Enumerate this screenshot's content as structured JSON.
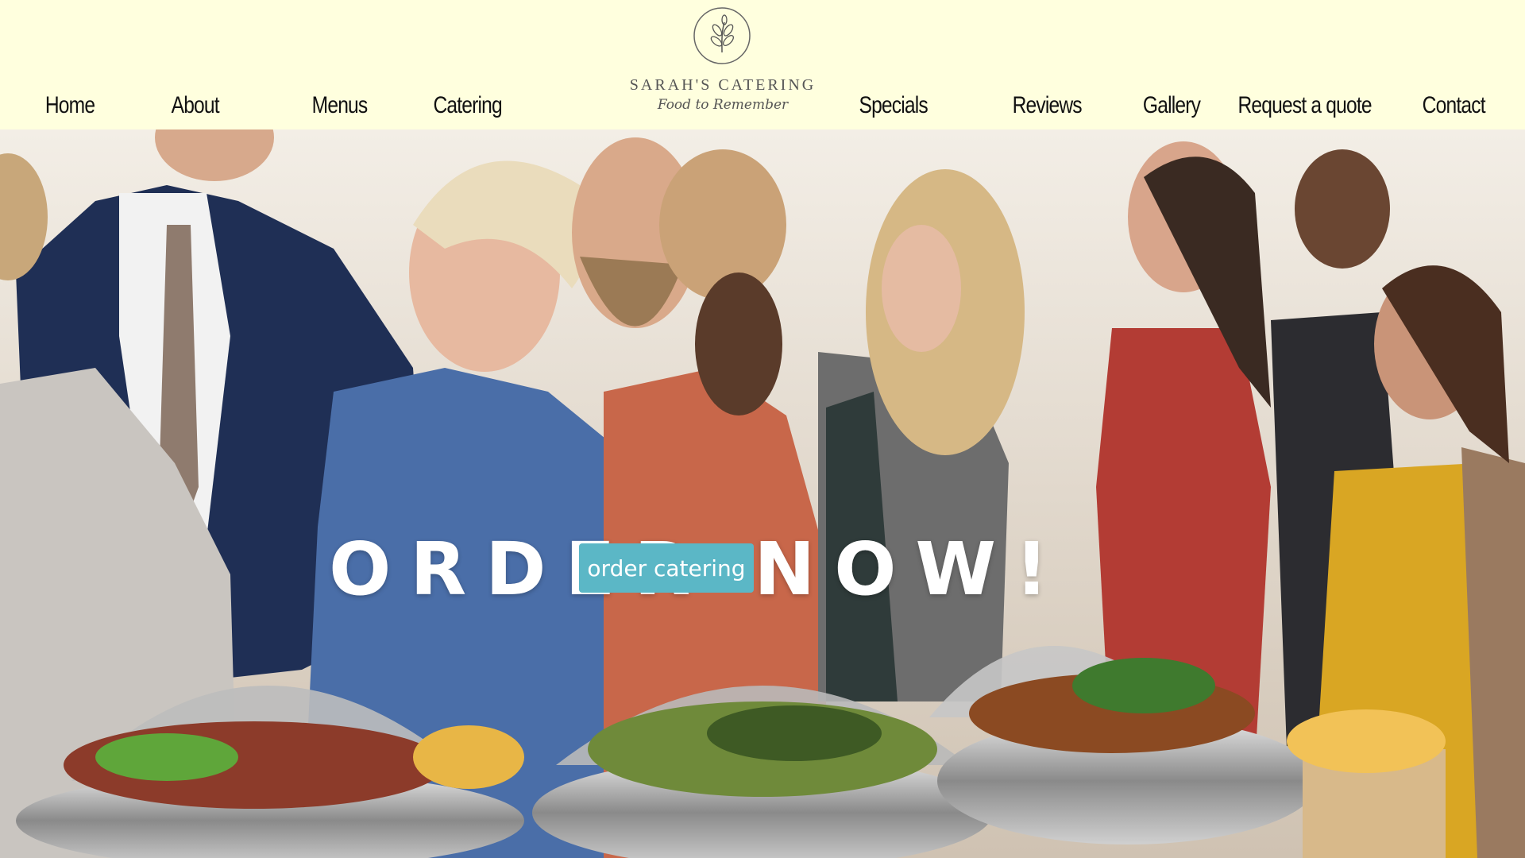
{
  "nav": {
    "left": [
      {
        "label": "Home"
      },
      {
        "label": "About"
      },
      {
        "label": "Menus"
      },
      {
        "label": "Catering"
      }
    ],
    "right": [
      {
        "label": "Specials"
      },
      {
        "label": "Reviews"
      },
      {
        "label": "Gallery"
      },
      {
        "label": "Request a quote"
      },
      {
        "label": "Contact"
      }
    ]
  },
  "logo": {
    "name": "SARAH'S CATERING",
    "tagline": "Food to Remember",
    "icon": "olive-branch-icon"
  },
  "hero": {
    "title": "ORDER NOW!",
    "cta_label": "order catering",
    "image": "catering-buffet-guests-photo"
  },
  "colors": {
    "header_bg": "#ffffde",
    "cta_bg": "#5bb7c6",
    "hero_text": "#ffffff"
  }
}
